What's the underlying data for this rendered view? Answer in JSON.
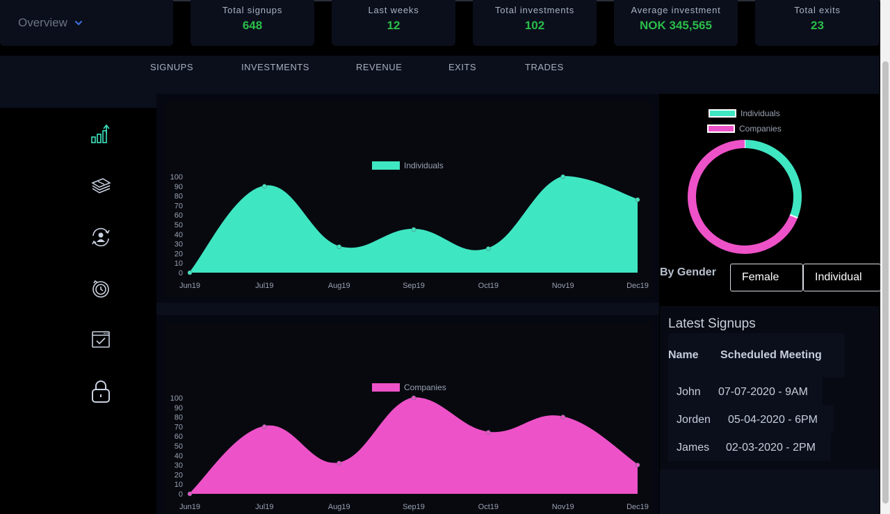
{
  "nav": {
    "overview_label": "Overview"
  },
  "stats": [
    {
      "label": "Total signups",
      "value": "648"
    },
    {
      "label": "Last weeks",
      "value": "12"
    },
    {
      "label": "Total investments",
      "value": "102"
    },
    {
      "label": "Average investment",
      "value": "NOK 345,565"
    },
    {
      "label": "Total exits",
      "value": "23"
    }
  ],
  "tabs": [
    "SIGNUPS",
    "INVESTMENTS",
    "REVENUE",
    "EXITS",
    "TRADES"
  ],
  "sidebar": {
    "icons": [
      "bar-chart-growth-icon",
      "money-stack-icon",
      "user-cycle-icon",
      "clock-history-icon",
      "calendar-check-icon",
      "lock-icon"
    ]
  },
  "colors": {
    "individuals": "#3fe6c2",
    "companies": "#ee52c8",
    "stat_value": "#2bbd4a"
  },
  "chart_data": [
    {
      "type": "area",
      "title": "",
      "categories": [
        "Jun19",
        "Jul19",
        "Aug19",
        "Sep19",
        "Oct19",
        "Nov19",
        "Dec19"
      ],
      "series": [
        {
          "name": "Individuals",
          "values": [
            0,
            90,
            27,
            45,
            25,
            100,
            76
          ]
        }
      ],
      "ylim": [
        0,
        100
      ],
      "yticks": [
        0,
        10,
        20,
        30,
        40,
        50,
        60,
        70,
        80,
        90,
        100
      ],
      "legend": "top-center"
    },
    {
      "type": "area",
      "title": "",
      "categories": [
        "Jun19",
        "Jul19",
        "Aug19",
        "Sep19",
        "Oct19",
        "Nov19",
        "Dec19"
      ],
      "series": [
        {
          "name": "Companies",
          "values": [
            0,
            70,
            32,
            100,
            64,
            80,
            30
          ]
        }
      ],
      "ylim": [
        0,
        100
      ],
      "yticks": [
        0,
        10,
        20,
        30,
        40,
        50,
        60,
        70,
        80,
        90,
        100
      ],
      "legend": "top-center"
    },
    {
      "type": "pie",
      "title": "",
      "categories": [
        "Individuals",
        "Companies"
      ],
      "values": [
        0.31,
        0.69
      ],
      "legend": "top"
    }
  ],
  "gender": {
    "label": "By Gender",
    "gender_value": "Female",
    "type_value": "Individual"
  },
  "signups": {
    "title": "Latest Signups",
    "columns": [
      "Name",
      "Scheduled Meeting"
    ],
    "rows": [
      {
        "name": "John",
        "meeting": "07-07-2020 - 9AM"
      },
      {
        "name": "Jorden",
        "meeting": "05-04-2020 - 6PM"
      },
      {
        "name": "James",
        "meeting": "02-03-2020 - 2PM"
      }
    ]
  }
}
